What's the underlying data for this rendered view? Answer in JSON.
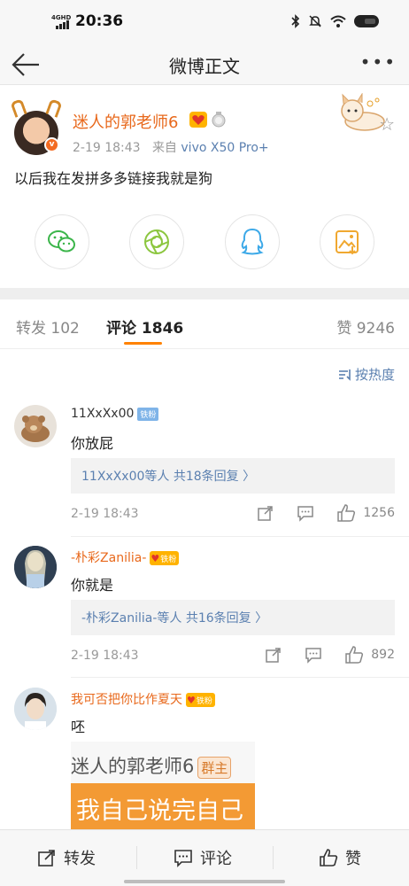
{
  "status": {
    "net_label": "4GHD",
    "time": "20:36"
  },
  "nav": {
    "title": "微博正文",
    "more": "•••"
  },
  "post": {
    "author": "迷人的郭老师6",
    "date": "2-19 18:43",
    "from_label": "来自",
    "device": "vivo X50 Pro+",
    "verified_mark": "v",
    "text": "以后我在发拼多多链接我就是狗",
    "share_icons": [
      "wechat-icon",
      "moments-icon",
      "qq-icon",
      "save-image-icon"
    ]
  },
  "tabs": [
    {
      "label": "转发",
      "count": "102"
    },
    {
      "label": "评论",
      "count": "1846"
    },
    {
      "label": "赞",
      "count": "9246"
    }
  ],
  "sort": {
    "label": "按热度"
  },
  "comments": [
    {
      "name": "11XxXx00",
      "badge": "铁粉",
      "text": "你放屁",
      "replies_name": "11XxXx00等人",
      "replies_count": "共18条回复 〉",
      "date": "2-19 18:43",
      "likes": "1256"
    },
    {
      "name": "-朴彩Zanilia-",
      "badge": "铁粉",
      "text": "你就是",
      "replies_name": "-朴彩Zanilia-等人",
      "replies_count": "共16条回复 〉",
      "date": "2-19 18:43",
      "likes": "892"
    },
    {
      "name": "我可否把你比作夏天",
      "badge": "铁粉",
      "text": "呸",
      "image_line1": "迷人的郭老师6",
      "image_tag": "群主",
      "image_line2": "我自己说完自己"
    }
  ],
  "bottom": {
    "repost": "转发",
    "comment": "评论",
    "like": "赞"
  },
  "colors": {
    "accent": "#ff8200",
    "name_orange": "#e8681b",
    "link_blue": "#5b80b0"
  }
}
